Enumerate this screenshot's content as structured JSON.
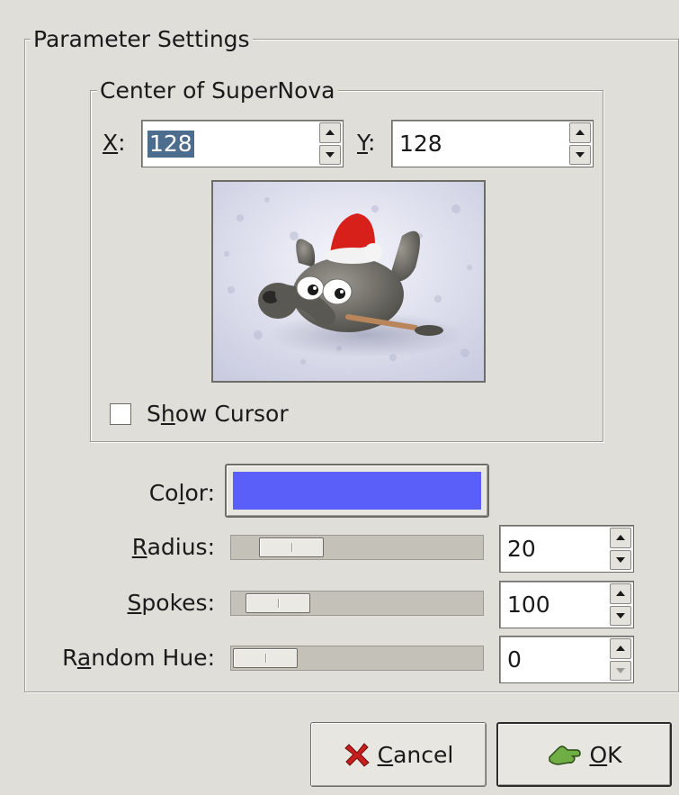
{
  "param_frame": {
    "title": "Parameter Settings"
  },
  "center_frame": {
    "title": "Center of SuperNova"
  },
  "x": {
    "mnemonic": "X",
    "rest": ":",
    "value": "128"
  },
  "y": {
    "mnemonic": "Y",
    "rest": ":",
    "value": "128"
  },
  "show_cursor": {
    "pre": "S",
    "mnemonic": "h",
    "post": "ow Cursor",
    "checked": false
  },
  "color": {
    "pre": "Co",
    "mnemonic": "l",
    "post": "or:",
    "value": "#5b5ff9"
  },
  "radius": {
    "mnemonic": "R",
    "post": "adius:",
    "value": "20",
    "slider_fraction": 0.14
  },
  "spokes": {
    "mnemonic": "S",
    "post": "pokes:",
    "value": "100",
    "slider_fraction": 0.07
  },
  "random_hue": {
    "pre": "R",
    "mnemonic": "a",
    "post": "ndom Hue:",
    "value": "0",
    "slider_fraction": 0.0
  },
  "buttons": {
    "cancel": {
      "mnemonic": "C",
      "post": "ancel",
      "icon": "cancel-x-icon"
    },
    "ok": {
      "mnemonic": "O",
      "post": "K",
      "icon": "ok-hand-icon"
    }
  },
  "colors": {
    "background": "#e0ded8",
    "selection": "#4d6d8f",
    "color_swatch": "#5b5ff9",
    "cancel_icon": "#c81e1e",
    "ok_icon": "#5f9a3c"
  }
}
